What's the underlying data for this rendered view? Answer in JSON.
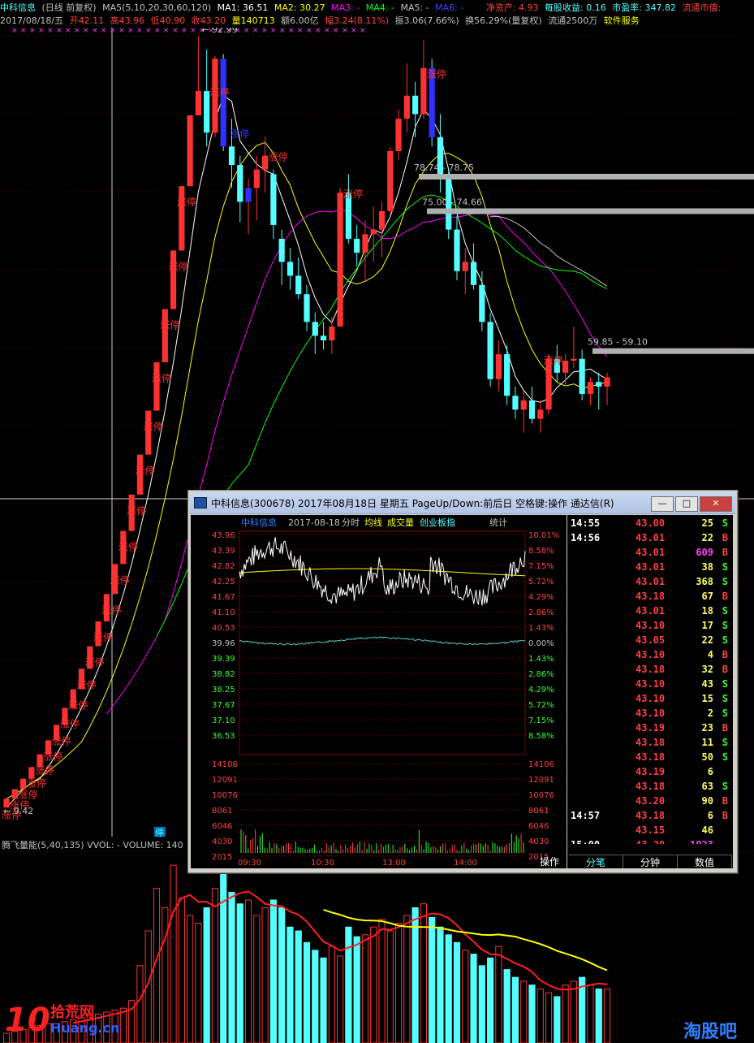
{
  "header": {
    "line1": {
      "name": "中科信息",
      "period": "(日线 前复权)",
      "ma_label": "MA5(5,10,20,30,60,120)",
      "ma1": "MA1: 36.51",
      "ma2": "MA2: 30.27",
      "ma3": "MA3: -",
      "ma4": "MA4: -",
      "ma5": "MA5: -",
      "ma6": "MA6: -",
      "net_asset": "净资产: 4.93",
      "eps": "每股收益: 0.16",
      "pe": "市盈率: 347.82",
      "float_mv": "流通市值:"
    },
    "line2": {
      "date": "2017/08/18/五",
      "open": "开42.11",
      "high": "高43.96",
      "low": "低40.90",
      "close": "收43.20",
      "volume": "量140713",
      "amount": "额6.00亿",
      "change": "幅3.24(8.11%)",
      "amplitude": "振3.06(7.66%)",
      "turnover": "换56.29%(量复权)",
      "float": "流通2500万",
      "service": "软件服务"
    }
  },
  "chart_data": {
    "type": "candlestick",
    "marks": {
      "high": "92.99",
      "low": "9.42",
      "zone1": "78.74 - 78.75",
      "zone2": "75.00 - 74.66",
      "zone3": "59.85 - 59.10",
      "limit_up": "涨停",
      "stop": "停"
    },
    "volume_indicator": "腾飞量能(5,40,135) VVOL: -  VOLUME: 140",
    "ohlc": [
      [
        9.42,
        10.36,
        9.42,
        10.36
      ],
      [
        10.36,
        11.4,
        10.36,
        11.4
      ],
      [
        11.4,
        12.54,
        11.4,
        12.54
      ],
      [
        12.54,
        13.79,
        12.54,
        13.79
      ],
      [
        13.79,
        15.17,
        13.79,
        15.17
      ],
      [
        15.17,
        16.69,
        15.17,
        16.69
      ],
      [
        16.69,
        18.36,
        16.69,
        18.36
      ],
      [
        18.36,
        20.2,
        18.36,
        20.2
      ],
      [
        20.2,
        22.22,
        20.2,
        22.22
      ],
      [
        22.22,
        24.44,
        22.22,
        24.44
      ],
      [
        24.44,
        26.88,
        24.44,
        26.88
      ],
      [
        26.88,
        29.57,
        26.88,
        29.57
      ],
      [
        29.57,
        32.53,
        29.57,
        32.53
      ],
      [
        32.53,
        35.78,
        32.53,
        35.78
      ],
      [
        35.78,
        39.36,
        35.78,
        39.36
      ],
      [
        39.36,
        43.3,
        39.36,
        43.3
      ],
      [
        43.3,
        47.63,
        43.3,
        47.63
      ],
      [
        47.63,
        52.39,
        47.63,
        52.39
      ],
      [
        52.39,
        57.63,
        52.39,
        57.63
      ],
      [
        57.63,
        63.39,
        57.63,
        63.39
      ],
      [
        63.39,
        69.73,
        63.39,
        69.73
      ],
      [
        69.73,
        76.7,
        69.73,
        76.7
      ],
      [
        76.7,
        84.37,
        76.7,
        84.37
      ],
      [
        84.37,
        92.99,
        84.37,
        87.0
      ],
      [
        87.0,
        91.5,
        81.0,
        82.5
      ],
      [
        82.5,
        90.8,
        82.0,
        90.5
      ],
      [
        90.5,
        91.0,
        80.5,
        81.0
      ],
      [
        81.0,
        84.0,
        76.5,
        79.0
      ],
      [
        79.0,
        80.0,
        72.8,
        75.0
      ],
      [
        75.0,
        77.5,
        71.5,
        76.5
      ],
      [
        76.5,
        80.0,
        73.0,
        78.5
      ],
      [
        78.5,
        82.0,
        76.0,
        80.0
      ],
      [
        78.0,
        78.5,
        71.0,
        72.5
      ],
      [
        71.0,
        72.0,
        66.0,
        68.5
      ],
      [
        68.5,
        70.0,
        65.5,
        67.0
      ],
      [
        67.0,
        69.0,
        64.5,
        65.0
      ],
      [
        65.0,
        66.0,
        61.0,
        62.0
      ],
      [
        62.0,
        63.0,
        58.5,
        60.5
      ],
      [
        60.5,
        62.0,
        59.0,
        60.0
      ],
      [
        60.0,
        62.5,
        58.5,
        61.5
      ],
      [
        61.5,
        76.5,
        61.5,
        76.0
      ],
      [
        76.0,
        78.0,
        70.5,
        71.0
      ],
      [
        71.0,
        72.5,
        68.0,
        69.5
      ],
      [
        69.5,
        73.0,
        66.5,
        71.5
      ],
      [
        71.5,
        74.5,
        68.5,
        72.0
      ],
      [
        72.0,
        75.0,
        69.0,
        74.0
      ],
      [
        74.0,
        81.0,
        73.5,
        80.5
      ],
      [
        80.5,
        85.0,
        79.5,
        84.0
      ],
      [
        84.0,
        90.0,
        82.5,
        86.5
      ],
      [
        86.5,
        88.0,
        82.0,
        84.5
      ],
      [
        84.5,
        92.5,
        84.0,
        89.5
      ],
      [
        89.5,
        90.5,
        81.0,
        82.0
      ],
      [
        82.0,
        84.5,
        76.0,
        77.5
      ],
      [
        77.5,
        78.5,
        71.0,
        72.0
      ],
      [
        72.0,
        73.5,
        66.5,
        67.5
      ],
      [
        67.5,
        70.0,
        65.0,
        68.5
      ],
      [
        68.5,
        70.5,
        65.5,
        66.0
      ],
      [
        66.0,
        67.5,
        61.0,
        62.0
      ],
      [
        62.0,
        63.0,
        55.0,
        55.8
      ],
      [
        55.8,
        60.0,
        54.5,
        58.5
      ],
      [
        58.5,
        59.5,
        53.0,
        54.0
      ],
      [
        54.0,
        55.0,
        51.5,
        52.5
      ],
      [
        52.5,
        54.5,
        50.0,
        53.5
      ],
      [
        53.5,
        55.0,
        51.0,
        51.5
      ],
      [
        51.5,
        53.5,
        50.0,
        52.5
      ],
      [
        52.5,
        58.5,
        52.0,
        58.0
      ],
      [
        58.0,
        59.5,
        55.5,
        56.5
      ],
      [
        56.5,
        58.5,
        55.0,
        57.8
      ],
      [
        57.8,
        61.5,
        57.0,
        58.0
      ],
      [
        58.0,
        59.0,
        53.5,
        54.2
      ],
      [
        54.2,
        56.0,
        53.0,
        55.5
      ],
      [
        55.5,
        56.5,
        52.5,
        55.0
      ],
      [
        55.0,
        56.5,
        53.0,
        56.0
      ]
    ],
    "ma5": [
      9.4,
      10.4,
      11.4,
      12.1,
      12.5,
      13.8,
      15.2,
      16.7,
      18.4,
      20.2,
      22.2,
      24.4,
      26.9,
      29.6,
      32.5,
      35.8,
      39.4,
      43.3,
      47.6,
      52.4,
      57.6,
      63.4,
      69.7,
      76.1,
      80.0,
      83.8,
      86.5,
      85.9,
      81.6,
      80.3,
      79.1,
      78.4,
      78.0,
      75.5,
      73.0,
      70.3,
      67.0,
      64.6,
      62.8,
      61.9,
      64.0,
      65.9,
      67.6,
      69.9,
      72.0,
      71.6,
      73.4,
      76.0,
      79.3,
      83.1,
      85.0,
      84.0,
      82.3,
      78.5,
      73.8,
      70.5,
      68.3,
      66.3,
      63.4,
      61.2,
      58.9,
      56.1,
      54.6,
      53.5,
      53.3,
      53.7,
      54.9,
      55.7,
      56.6,
      56.7,
      56.9,
      56.3,
      55.8
    ],
    "volume": [
      5,
      6,
      7,
      8,
      9,
      10,
      10,
      11,
      12,
      13,
      14,
      15,
      16,
      17,
      18,
      22,
      40,
      58,
      80,
      70,
      92,
      75,
      66,
      62,
      70,
      80,
      88,
      78,
      72,
      74,
      66,
      70,
      74,
      70,
      60,
      58,
      52,
      48,
      44,
      50,
      45,
      60,
      55,
      56,
      60,
      64,
      58,
      62,
      66,
      70,
      72,
      65,
      60,
      56,
      52,
      48,
      46,
      40,
      44,
      50,
      38,
      34,
      32,
      30,
      28,
      26,
      24,
      30,
      32,
      34,
      30,
      28,
      28
    ],
    "intraday": {
      "stock_name": "中科信息",
      "date": "2017-08-18",
      "label_fenshi": "分时",
      "label_avg": "均线",
      "label_vol": "成交量",
      "label_index": "创业板指",
      "label_stats": "统计",
      "price_ticks": [
        "43.96",
        "43.39",
        "42.82",
        "42.25",
        "41.67",
        "41.10",
        "40.53",
        "39.96",
        "39.39",
        "38.82",
        "38.25",
        "37.67",
        "37.10",
        "36.53"
      ],
      "pct_ticks": [
        "10.01%",
        "8.58%",
        "7.15%",
        "5.72%",
        "4.29%",
        "2.86%",
        "1.43%",
        "0.00%",
        "1.43%",
        "2.86%",
        "4.29%",
        "5.72%",
        "7.15%",
        "8.58%"
      ],
      "vol_ticks": [
        "14106",
        "12091",
        "10076",
        "8061",
        "6046",
        "4030",
        "2015"
      ],
      "time_ticks": [
        "09:30",
        "10:30",
        "13:00",
        "14:00"
      ]
    }
  },
  "popup": {
    "title": "中科信息(300678) 2017年08月18日 星期五 PageUp/Down:前后日 空格键:操作 通达信(R)",
    "btn_min": "—",
    "btn_max": "□",
    "btn_close": "✕",
    "ticks": [
      {
        "time": "14:55",
        "price": "43.00",
        "vol": "25",
        "side": "S"
      },
      {
        "time": "14:56",
        "price": "43.01",
        "vol": "22",
        "side": "B"
      },
      {
        "time": "",
        "price": "43.01",
        "vol": "609",
        "side": "B"
      },
      {
        "time": "",
        "price": "43.01",
        "vol": "38",
        "side": "S"
      },
      {
        "time": "",
        "price": "43.01",
        "vol": "368",
        "side": "S"
      },
      {
        "time": "",
        "price": "43.18",
        "vol": "67",
        "side": "B"
      },
      {
        "time": "",
        "price": "43.01",
        "vol": "18",
        "side": "S"
      },
      {
        "time": "",
        "price": "43.10",
        "vol": "17",
        "side": "S"
      },
      {
        "time": "",
        "price": "43.05",
        "vol": "22",
        "side": "S"
      },
      {
        "time": "",
        "price": "43.10",
        "vol": "4",
        "side": "B"
      },
      {
        "time": "",
        "price": "43.18",
        "vol": "32",
        "side": "B"
      },
      {
        "time": "",
        "price": "43.10",
        "vol": "43",
        "side": "S"
      },
      {
        "time": "",
        "price": "43.10",
        "vol": "15",
        "side": "S"
      },
      {
        "time": "",
        "price": "43.10",
        "vol": "2",
        "side": "S"
      },
      {
        "time": "",
        "price": "43.19",
        "vol": "23",
        "side": "B"
      },
      {
        "time": "",
        "price": "43.18",
        "vol": "11",
        "side": "S"
      },
      {
        "time": "",
        "price": "43.18",
        "vol": "50",
        "side": "S"
      },
      {
        "time": "",
        "price": "43.19",
        "vol": "6",
        "side": ""
      },
      {
        "time": "",
        "price": "43.18",
        "vol": "63",
        "side": "S"
      },
      {
        "time": "",
        "price": "43.20",
        "vol": "90",
        "side": "B"
      },
      {
        "time": "14:57",
        "price": "43.18",
        "vol": "6",
        "side": "B"
      },
      {
        "time": "",
        "price": "43.15",
        "vol": "46",
        "side": ""
      },
      {
        "time": "15:00",
        "price": "43.20",
        "vol": "1923",
        "side": ""
      }
    ],
    "tabs": {
      "op": "操作",
      "t1": "分笔",
      "t2": "分钟",
      "t3": "数值"
    }
  },
  "watermarks": {
    "left_logo": "10",
    "left_cn": "拾荒网",
    "left_en": "Huang.cn",
    "right": "淘股吧"
  },
  "colors": {
    "up": "#ff3232",
    "down": "#54ffff",
    "ma1": "#ffffff",
    "ma2": "#ffff00",
    "ma3": "#ff00ff",
    "ma4": "#00ff00",
    "ma5": "#c0c0c0"
  }
}
